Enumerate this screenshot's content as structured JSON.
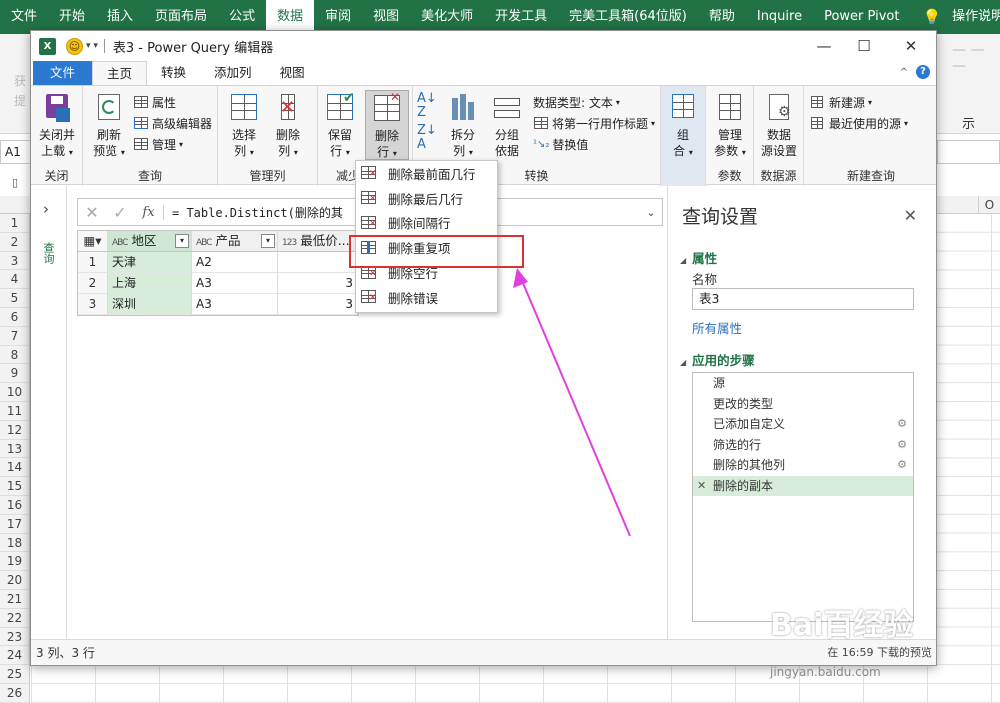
{
  "excel": {
    "menu": [
      "文件",
      "开始",
      "插入",
      "页面布局",
      "公式",
      "数据",
      "审阅",
      "视图",
      "美化大师",
      "开发工具",
      "完美工具箱(64位版)",
      "帮助",
      "Inquire",
      "Power Pivot"
    ],
    "active_menu": "数据",
    "tell_me": "操作说明搜索",
    "name_box": "A1",
    "col_o": "O",
    "rows": [
      "1",
      "2",
      "3",
      "4",
      "5",
      "6",
      "7",
      "8",
      "9",
      "10",
      "11",
      "12",
      "13",
      "14",
      "15",
      "16",
      "17",
      "18",
      "19",
      "20",
      "21",
      "22",
      "23",
      "24",
      "25",
      "26"
    ],
    "ghost_texts": [
      "获",
      "提",
      "示"
    ]
  },
  "pq": {
    "title": "表3 - Power Query 编辑器",
    "logo": "X",
    "tabs": {
      "file": "文件",
      "home": "主页",
      "transform": "转换",
      "add_column": "添加列",
      "view": "视图"
    },
    "ribbon": {
      "close_load": "关闭并\n上载",
      "group_close": "关闭",
      "refresh": "刷新\n预览",
      "properties": "属性",
      "advanced_editor": "高级编辑器",
      "manage": "管理",
      "group_query": "查询",
      "choose_cols": "选择\n列",
      "remove_cols": "删除\n列",
      "group_manage_cols": "管理列",
      "keep_rows": "保留\n行",
      "remove_rows": "删除\n行",
      "group_reduce": "减少",
      "split": "拆分\n列",
      "group_by": "分组\n依据",
      "data_type": "数据类型: 文本",
      "first_row": "将第一行用作标题",
      "replace": "替换值",
      "group_transform": "转换",
      "combine": "组\n合",
      "manage_params": "管理\n参数",
      "group_params": "参数",
      "datasource": "数据\n源设置",
      "group_datasource": "数据源",
      "new_source": "新建源",
      "recent_sources": "最近使用的源",
      "group_new_query": "新建查询"
    },
    "menu_items": [
      "删除最前面几行",
      "删除最后几行",
      "删除间隔行",
      "删除重复项",
      "删除空行",
      "删除错误"
    ],
    "nav_label": "查询",
    "formula": "= Table.Distinct(删除的其",
    "fx": "fx",
    "grid": {
      "headers": [
        "地区",
        "产品",
        "最低价..."
      ],
      "type_icons": [
        "ABC",
        "ABC",
        "123"
      ],
      "rows": [
        {
          "n": "1",
          "region": "天津",
          "product": "A2",
          "price": ""
        },
        {
          "n": "2",
          "region": "上海",
          "product": "A3",
          "price": "3"
        },
        {
          "n": "3",
          "region": "深圳",
          "product": "A3",
          "price": "3"
        }
      ]
    },
    "settings": {
      "title": "查询设置",
      "properties": "属性",
      "name_label": "名称",
      "name_value": "表3",
      "all_props": "所有属性",
      "steps_title": "应用的步骤",
      "steps": [
        {
          "label": "源",
          "gear": false
        },
        {
          "label": "更改的类型",
          "gear": false
        },
        {
          "label": "已添加自定义",
          "gear": true
        },
        {
          "label": "筛选的行",
          "gear": true
        },
        {
          "label": "删除的其他列",
          "gear": true
        },
        {
          "label": "删除的副本",
          "gear": false,
          "active": true
        }
      ]
    },
    "status_left": "3 列、3 行",
    "status_right": "在 16:59 下载的预览"
  },
  "watermark": {
    "logo": "Bai百经验",
    "url": "jingyan.baidu.com"
  }
}
